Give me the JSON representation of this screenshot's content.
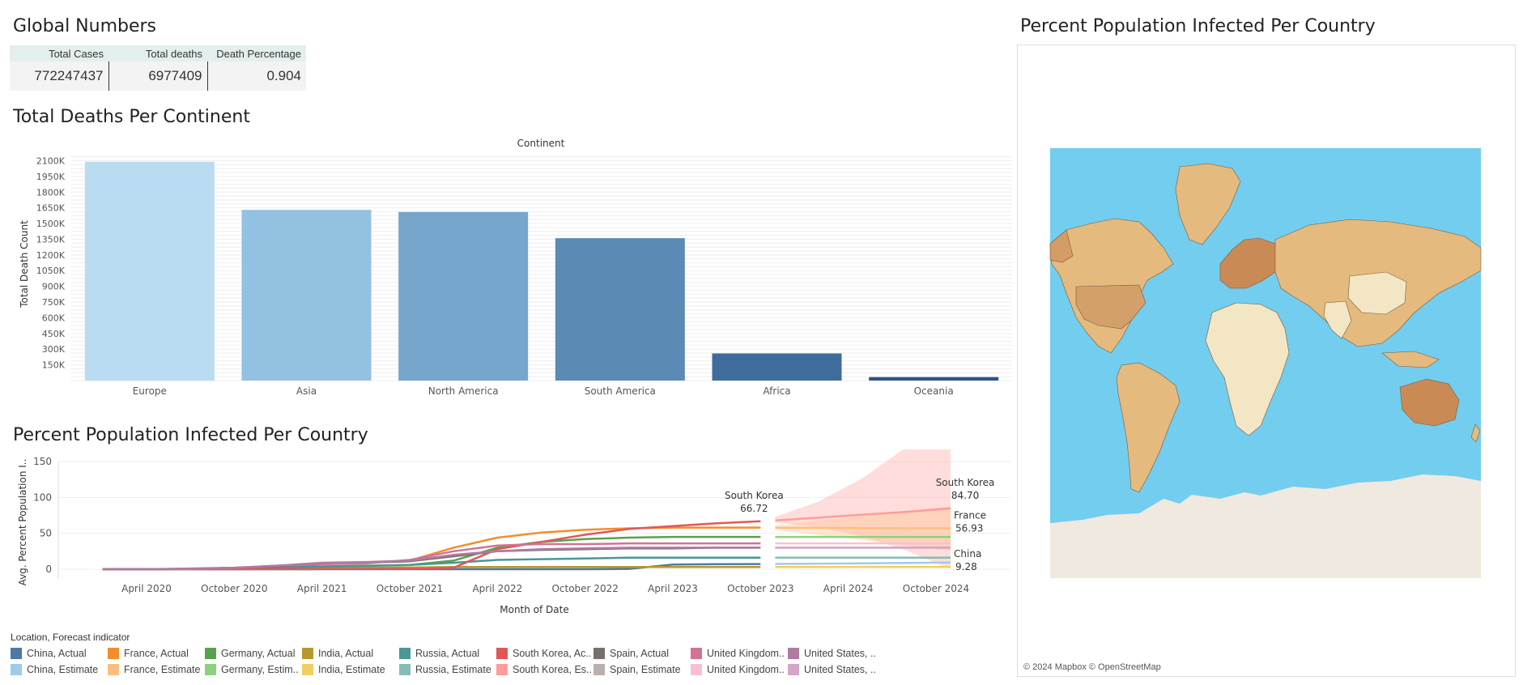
{
  "titles": {
    "global": "Global Numbers",
    "continent": "Total Deaths Per Continent",
    "line": "Percent Population Infected Per Country",
    "map": "Percent Population Infected Per Country"
  },
  "kpi": {
    "headers": [
      "Total Cases",
      "Total deaths",
      "Death Percentage"
    ],
    "values": [
      "772247437",
      "6977409",
      "0.904"
    ]
  },
  "chart_data": [
    {
      "type": "bar",
      "title": "Total Deaths Per Continent",
      "xlabel": "Continent",
      "ylabel": "Total Death Count",
      "categories": [
        "Europe",
        "Asia",
        "North America",
        "South America",
        "Africa",
        "Oceania"
      ],
      "values": [
        2090000,
        1630000,
        1610000,
        1360000,
        259000,
        33000
      ],
      "ylim": [
        0,
        2150000
      ],
      "yticks": [
        150000,
        300000,
        450000,
        600000,
        750000,
        900000,
        1050000,
        1200000,
        1350000,
        1500000,
        1650000,
        1800000,
        1950000,
        2100000
      ],
      "ytick_labels": [
        "150K",
        "300K",
        "450K",
        "600K",
        "750K",
        "900K",
        "1050K",
        "1200K",
        "1350K",
        "1500K",
        "1650K",
        "1800K",
        "1950K",
        "2100K"
      ],
      "colors": [
        "#b9dcf0",
        "#93c1e2",
        "#76a6cc",
        "#5b8bb4",
        "#3f6c9b",
        "#2c5683"
      ],
      "grid": true
    },
    {
      "type": "line",
      "title": "Percent Population Infected Per Country",
      "xlabel": "Month of Date",
      "ylabel": "Avg. Percent Population I..",
      "ylim": [
        -5,
        150
      ],
      "yticks": [
        0,
        50,
        100,
        150
      ],
      "xticks": [
        "April 2020",
        "October 2020",
        "April 2021",
        "October 2021",
        "April 2022",
        "October 2022",
        "April 2023",
        "October 2023",
        "April 2024",
        "October 2024"
      ],
      "x_months": [
        "2020-01",
        "2020-04",
        "2020-07",
        "2020-10",
        "2021-01",
        "2021-04",
        "2021-07",
        "2021-10",
        "2022-01",
        "2022-04",
        "2022-07",
        "2022-10",
        "2023-01",
        "2023-04",
        "2023-07",
        "2023-10"
      ],
      "forecast_months": [
        "2023-11",
        "2024-02",
        "2024-05",
        "2024-08",
        "2024-11"
      ],
      "series": [
        {
          "name": "China",
          "color": "#4e79a7",
          "est_color": "#a0cbe8",
          "actual": [
            0,
            0,
            0,
            0,
            0,
            0,
            0,
            0,
            0,
            0,
            0,
            0,
            0.5,
            6.5,
            7.0,
            7.2
          ],
          "forecast": [
            7.3,
            7.8,
            8.2,
            8.8,
            9.28
          ]
        },
        {
          "name": "France",
          "color": "#f28e2b",
          "est_color": "#ffbe7d",
          "actual": [
            0,
            0,
            0.5,
            2,
            5,
            8,
            9,
            12,
            30,
            44,
            51,
            55,
            57,
            58,
            58,
            58
          ],
          "forecast": [
            57.8,
            57.5,
            57.3,
            57.1,
            56.93
          ]
        },
        {
          "name": "Germany",
          "color": "#59a14f",
          "est_color": "#8cd17d",
          "actual": [
            0,
            0,
            0.3,
            1,
            3,
            4,
            5,
            6,
            12,
            30,
            38,
            42,
            44,
            45,
            45,
            45
          ],
          "forecast": [
            45,
            45,
            45,
            45,
            45
          ]
        },
        {
          "name": "India",
          "color": "#b6992d",
          "est_color": "#f1ce63",
          "actual": [
            0,
            0,
            0.5,
            0.8,
            0.8,
            1.2,
            2,
            2.4,
            3,
            3,
            3,
            3,
            3,
            3.1,
            3.2,
            3.2
          ],
          "forecast": [
            3.2,
            3.2,
            3.3,
            3.3,
            3.3
          ]
        },
        {
          "name": "Russia",
          "color": "#499894",
          "est_color": "#86bcb6",
          "actual": [
            0,
            0,
            0.3,
            1,
            2,
            3.5,
            4.5,
            6,
            9,
            13,
            14,
            15,
            16,
            16,
            16,
            16
          ],
          "forecast": [
            16,
            16,
            16,
            16,
            16
          ]
        },
        {
          "name": "South Korea",
          "color": "#e15759",
          "est_color": "#ff9d9a",
          "actual": [
            0,
            0,
            0,
            0,
            0.1,
            0.2,
            0.3,
            0.6,
            2,
            28,
            38,
            48,
            56,
            60,
            64,
            66.72
          ],
          "forecast": [
            68,
            72,
            76,
            80,
            84.7
          ]
        },
        {
          "name": "Spain",
          "color": "#79706e",
          "est_color": "#bab0ac",
          "actual": [
            0,
            0,
            0.6,
            2,
            4,
            7,
            9,
            11,
            18,
            25,
            27,
            28,
            29,
            29,
            30,
            30
          ],
          "forecast": [
            30,
            30,
            30,
            30,
            30
          ]
        },
        {
          "name": "United Kingdom",
          "color": "#d37295",
          "est_color": "#fabfd2",
          "actual": [
            0,
            0,
            0.5,
            2,
            5,
            7,
            8,
            13,
            25,
            33,
            35,
            35,
            36,
            36,
            36,
            36
          ],
          "forecast": [
            36,
            36,
            36,
            36,
            36
          ]
        },
        {
          "name": "United States",
          "color": "#b07aa1",
          "est_color": "#d4a6c8",
          "actual": [
            0,
            0,
            1,
            2,
            5,
            9,
            10,
            12,
            20,
            25,
            28,
            29,
            30,
            30,
            30,
            30
          ],
          "forecast": [
            30,
            30,
            30,
            30,
            30
          ]
        }
      ],
      "labels": [
        {
          "text": "South Korea",
          "value": "66.72"
        },
        {
          "text": "South Korea",
          "value": "84.70"
        },
        {
          "text": "France",
          "value": "56.93"
        },
        {
          "text": "China",
          "value": "9.28"
        }
      ]
    }
  ],
  "legend": {
    "title": "Location, Forecast indicator",
    "items": [
      {
        "label": "China, Actual",
        "color": "#4e79a7"
      },
      {
        "label": "China, Estimate",
        "color": "#a0cbe8"
      },
      {
        "label": "France, Actual",
        "color": "#f28e2b"
      },
      {
        "label": "France, Estimate",
        "color": "#ffbe7d"
      },
      {
        "label": "Germany, Actual",
        "color": "#59a14f"
      },
      {
        "label": "Germany, Estim..",
        "color": "#8cd17d"
      },
      {
        "label": "India, Actual",
        "color": "#b6992d"
      },
      {
        "label": "India, Estimate",
        "color": "#f1ce63"
      },
      {
        "label": "Russia, Actual",
        "color": "#499894"
      },
      {
        "label": "Russia, Estimate",
        "color": "#86bcb6"
      },
      {
        "label": "South Korea, Ac..",
        "color": "#e15759"
      },
      {
        "label": "South Korea, Es..",
        "color": "#ff9d9a"
      },
      {
        "label": "Spain, Actual",
        "color": "#79706e"
      },
      {
        "label": "Spain, Estimate",
        "color": "#bab0ac"
      },
      {
        "label": "United Kingdom..",
        "color": "#d37295"
      },
      {
        "label": "United Kingdom..",
        "color": "#fabfd2"
      },
      {
        "label": "United States, ..",
        "color": "#b07aa1"
      },
      {
        "label": "United States, ..",
        "color": "#d4a6c8"
      }
    ]
  },
  "map": {
    "credit": "© 2024 Mapbox © OpenStreetMap",
    "ocean_color": "#73cdef",
    "land_color": "#f0e9df"
  }
}
